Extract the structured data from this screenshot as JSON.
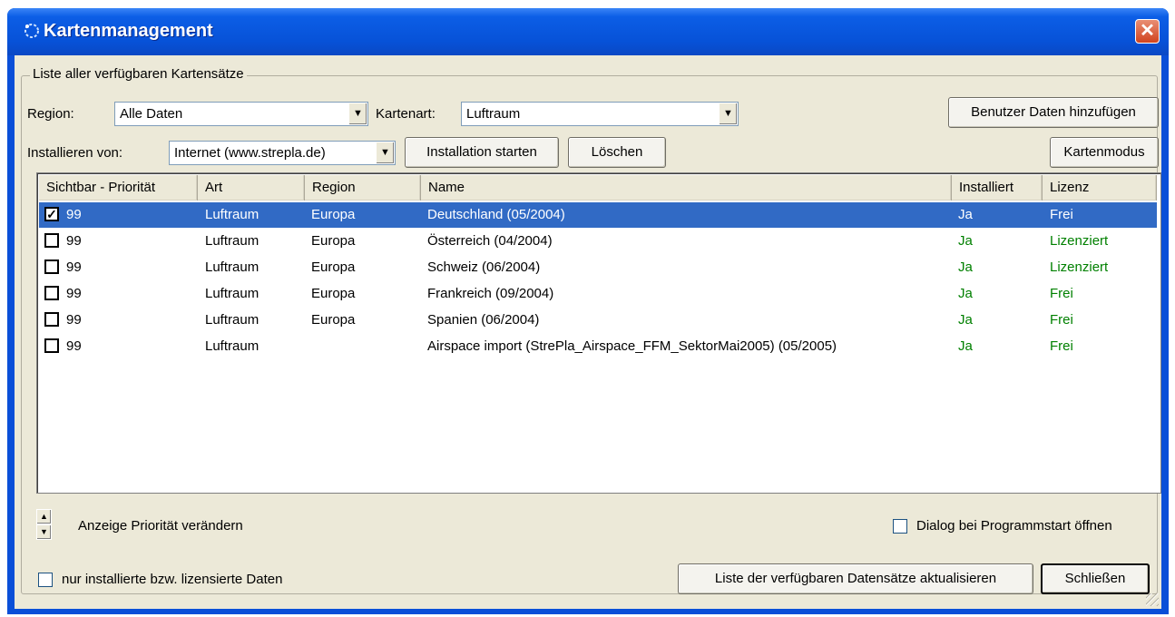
{
  "window": {
    "title": "Kartenmanagement",
    "close_glyph": "✕"
  },
  "group": {
    "legend": "Liste aller verfügbaren Kartensätze"
  },
  "filters": {
    "region_label": "Region:",
    "region_value": "Alle Daten",
    "type_label": "Kartenart:",
    "type_value": "Luftraum",
    "install_label": "Installieren von:",
    "install_value": "Internet (www.strepla.de)"
  },
  "buttons": {
    "add_user_data": "Benutzer Daten hinzufügen",
    "install_start": "Installation starten",
    "delete": "Löschen",
    "map_mode": "Kartenmodus",
    "refresh_list": "Liste der verfügbaren Datensätze aktualisieren",
    "close": "Schließen"
  },
  "table": {
    "columns": [
      "Sichtbar - Priorität",
      "Art",
      "Region",
      "Name",
      "Installiert",
      "Lizenz"
    ],
    "rows": [
      {
        "checked": true,
        "priority": "99",
        "type": "Luftraum",
        "region": "Europa",
        "name": "Deutschland (05/2004)",
        "installed": "Ja",
        "license": "Frei",
        "selected": true
      },
      {
        "checked": false,
        "priority": "99",
        "type": "Luftraum",
        "region": "Europa",
        "name": "Österreich (04/2004)",
        "installed": "Ja",
        "license": "Lizenziert"
      },
      {
        "checked": false,
        "priority": "99",
        "type": "Luftraum",
        "region": "Europa",
        "name": "Schweiz (06/2004)",
        "installed": "Ja",
        "license": "Lizenziert"
      },
      {
        "checked": false,
        "priority": "99",
        "type": "Luftraum",
        "region": "Europa",
        "name": "Frankreich (09/2004)",
        "installed": "Ja",
        "license": "Frei"
      },
      {
        "checked": false,
        "priority": "99",
        "type": "Luftraum",
        "region": "Europa",
        "name": "Spanien (06/2004)",
        "installed": "Ja",
        "license": "Frei"
      },
      {
        "checked": false,
        "priority": "99",
        "type": "Luftraum",
        "region": "",
        "name": "Airspace import (StrePla_Airspace_FFM_SektorMai2005) (05/2005)",
        "installed": "Ja",
        "license": "Frei"
      }
    ]
  },
  "bottom": {
    "priority_label": "Anzeige Priorität verändern",
    "dialog_on_start": "Dialog bei Programmstart öffnen",
    "only_installed": "nur installierte bzw. lizensierte Daten"
  },
  "colors": {
    "selection": "#316ac5",
    "status_green": "#008000",
    "titlebar": "#0752d8"
  }
}
